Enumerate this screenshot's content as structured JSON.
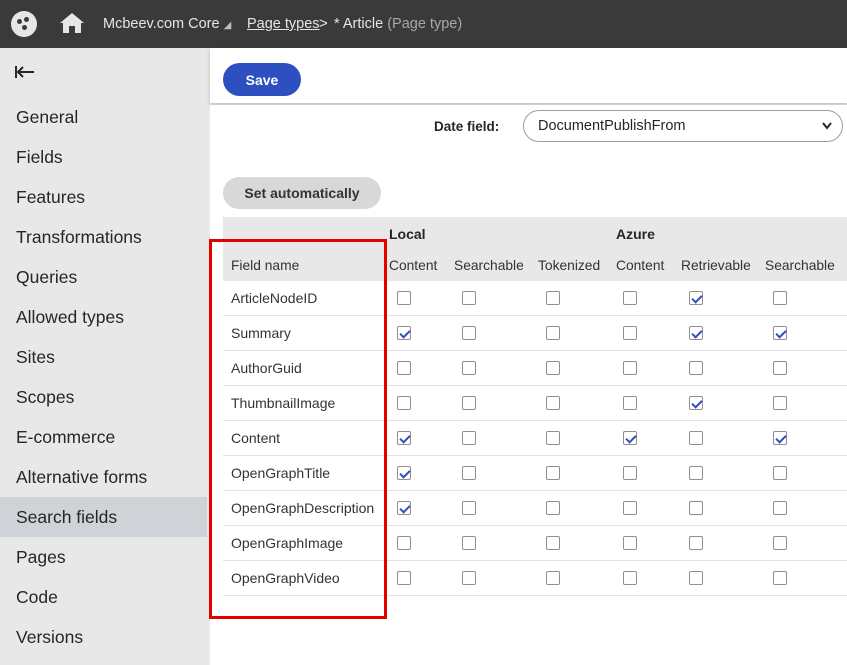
{
  "topbar": {
    "site_name": "Mcbeev.com Core",
    "site_caret": "◢",
    "breadcrumb_link": "Page types",
    "breadcrumb_separator": ">",
    "breadcrumb_current": "* Article",
    "breadcrumb_current_type": "(Page type)"
  },
  "sidebar": {
    "items": [
      "General",
      "Fields",
      "Features",
      "Transformations",
      "Queries",
      "Allowed types",
      "Sites",
      "Scopes",
      "E-commerce",
      "Alternative forms",
      "Search fields",
      "Pages",
      "Code",
      "Versions"
    ],
    "active_item": "Search fields"
  },
  "toolbar": {
    "save_label": "Save"
  },
  "date_field": {
    "label": "Date field:",
    "value": "DocumentPublishFrom"
  },
  "set_automatically_label": "Set automatically",
  "table": {
    "groups": {
      "local": "Local",
      "azure": "Azure"
    },
    "field_header": "Field name",
    "columns": [
      "Content",
      "Searchable",
      "Tokenized",
      "Content",
      "Retrievable",
      "Searchable"
    ],
    "rows": [
      {
        "name": "ArticleNodeID",
        "checks": [
          false,
          false,
          false,
          false,
          true,
          false
        ]
      },
      {
        "name": "Summary",
        "checks": [
          true,
          false,
          false,
          false,
          true,
          true
        ]
      },
      {
        "name": "AuthorGuid",
        "checks": [
          false,
          false,
          false,
          false,
          false,
          false
        ]
      },
      {
        "name": "ThumbnailImage",
        "checks": [
          false,
          false,
          false,
          false,
          true,
          false
        ]
      },
      {
        "name": "Content",
        "checks": [
          true,
          false,
          false,
          true,
          false,
          true
        ]
      },
      {
        "name": "OpenGraphTitle",
        "checks": [
          true,
          false,
          false,
          false,
          false,
          false
        ]
      },
      {
        "name": "OpenGraphDescription",
        "checks": [
          true,
          false,
          false,
          false,
          false,
          false
        ]
      },
      {
        "name": "OpenGraphImage",
        "checks": [
          false,
          false,
          false,
          false,
          false,
          false
        ]
      },
      {
        "name": "OpenGraphVideo",
        "checks": [
          false,
          false,
          false,
          false,
          false,
          false
        ]
      }
    ]
  },
  "colors": {
    "accent": "#2e4fbf",
    "highlight": "#e50000",
    "topbar": "#3a3a3a",
    "sidebar": "#e8e8e8"
  }
}
